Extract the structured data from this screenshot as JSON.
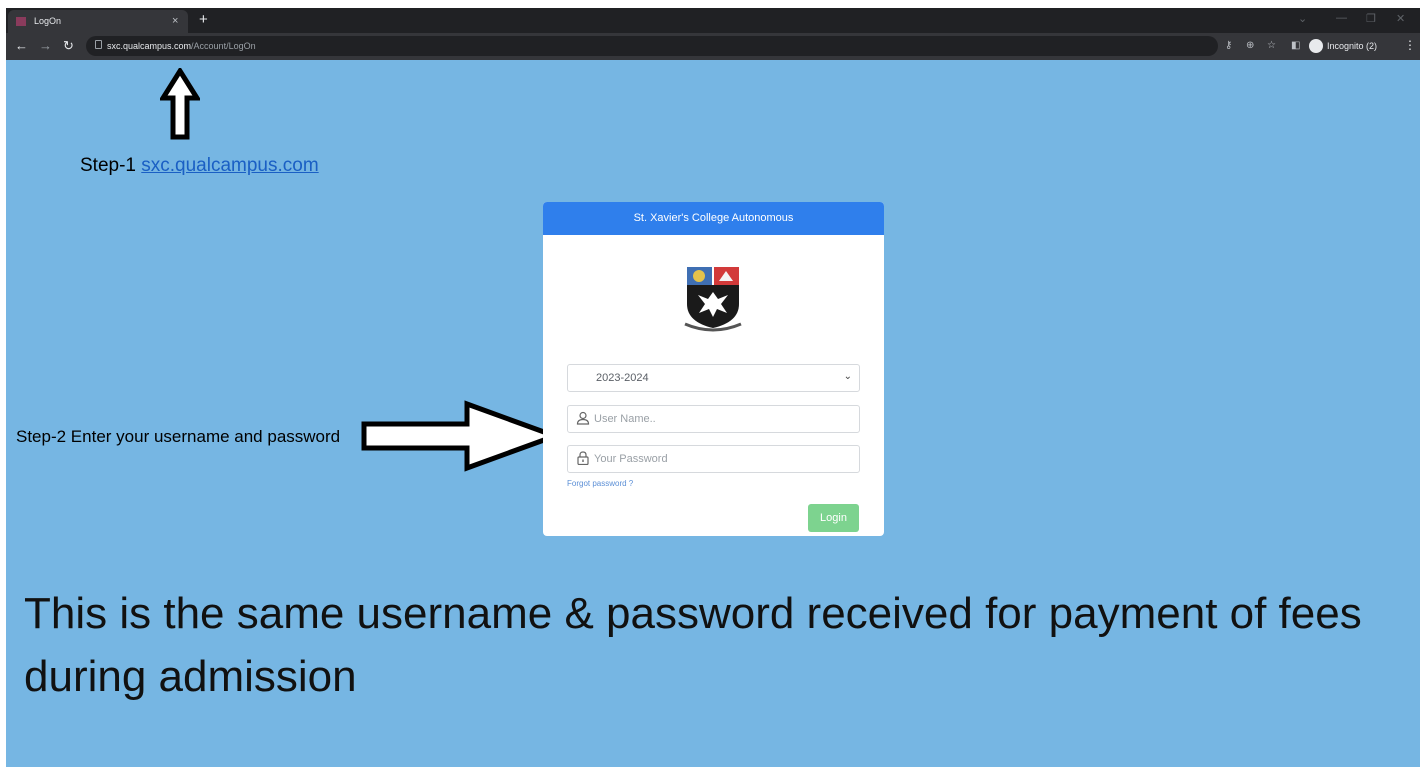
{
  "browser": {
    "tab_title": "LogOn",
    "tab_close": "×",
    "new_tab": "+",
    "url_host": "sxc.qualcampus.com",
    "url_path": "/Account/LogOn",
    "profile_label": "Incognito (2)"
  },
  "annotations": {
    "step1_prefix": "Step-1 ",
    "step1_link": "sxc.qualcampus.com",
    "step2": "Step-2 Enter your username and password",
    "note": "This is the same username & password received for payment of fees during admission"
  },
  "login_card": {
    "header": "St. Xavier's College Autonomous",
    "year_selected": "2023-2024",
    "username_placeholder": "User Name..",
    "password_placeholder": "Your Password",
    "forgot_link": "Forgot password ?",
    "login_button": "Login"
  },
  "colors": {
    "page_background": "#76b6e3",
    "card_header": "#2f7fec",
    "login_button": "#7dd38f",
    "link": "#1a5fc4"
  },
  "icons": [
    "arrow-up-icon",
    "arrow-right-icon",
    "college-crest-logo",
    "user-icon",
    "lock-icon",
    "chevron-down-icon"
  ]
}
